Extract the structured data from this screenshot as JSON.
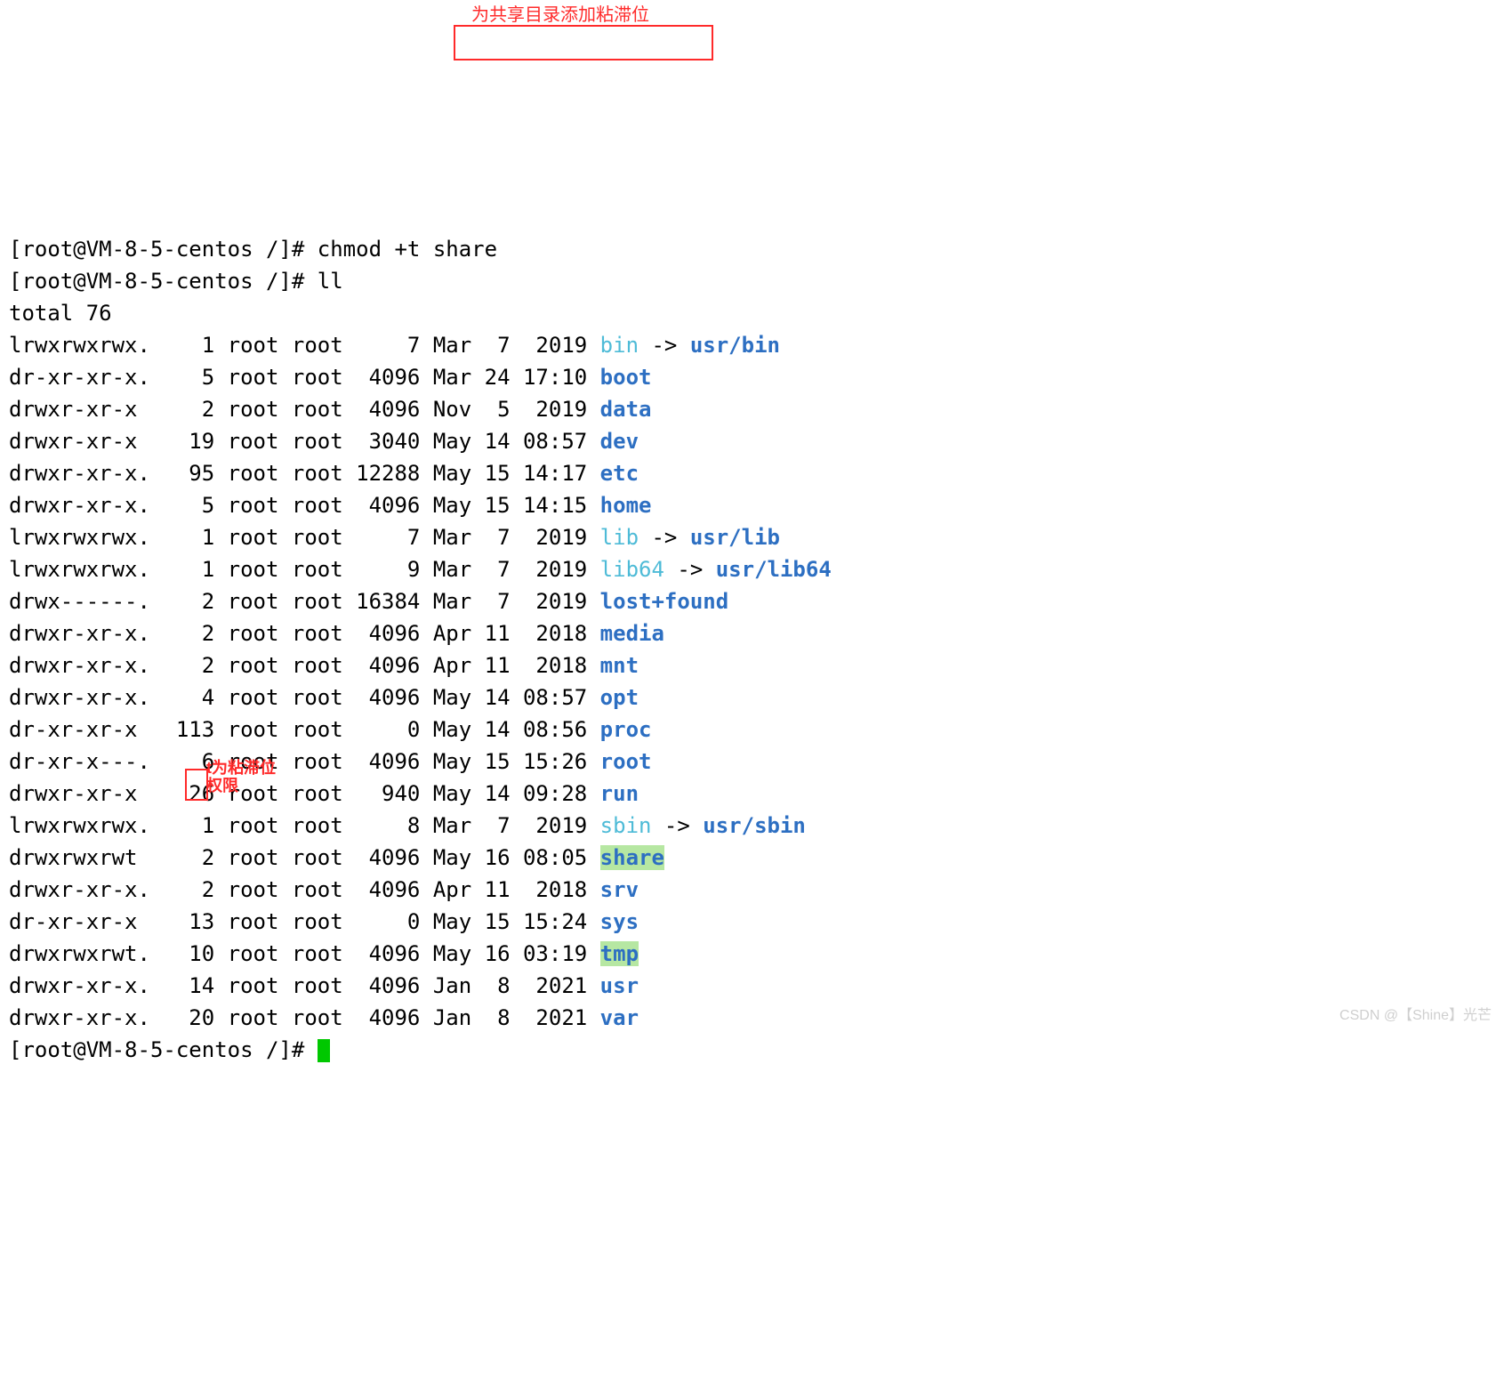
{
  "annotations": {
    "top_note": "为共享目录添加粘滞位",
    "mid_note": "t为粘滞位权限"
  },
  "watermark": "CSDN @【Shine】光芒",
  "prompt_line1_prefix": "[root@VM-8-5-centos /]# ",
  "prompt_line1_cmd": "chmod +t share",
  "prompt_line2_prefix": "[root@VM-8-5-centos /]# ",
  "prompt_line2_cmd": "ll",
  "total_line": "total 76",
  "rows": [
    {
      "perm": "lrwxrwxrwx.",
      "links": "1",
      "owner": "root",
      "group": "root",
      "size": "7",
      "month": "Mar",
      "day": "7",
      "time": "2019",
      "name": "bin",
      "cls": "cyan",
      "link": "usr/bin",
      "lcls": "blue"
    },
    {
      "perm": "dr-xr-xr-x.",
      "links": "5",
      "owner": "root",
      "group": "root",
      "size": "4096",
      "month": "Mar",
      "day": "24",
      "time": "17:10",
      "name": "boot",
      "cls": "blue"
    },
    {
      "perm": "drwxr-xr-x",
      "links": "2",
      "owner": "root",
      "group": "root",
      "size": "4096",
      "month": "Nov",
      "day": "5",
      "time": "2019",
      "name": "data",
      "cls": "blue"
    },
    {
      "perm": "drwxr-xr-x",
      "links": "19",
      "owner": "root",
      "group": "root",
      "size": "3040",
      "month": "May",
      "day": "14",
      "time": "08:57",
      "name": "dev",
      "cls": "blue"
    },
    {
      "perm": "drwxr-xr-x.",
      "links": "95",
      "owner": "root",
      "group": "root",
      "size": "12288",
      "month": "May",
      "day": "15",
      "time": "14:17",
      "name": "etc",
      "cls": "blue"
    },
    {
      "perm": "drwxr-xr-x.",
      "links": "5",
      "owner": "root",
      "group": "root",
      "size": "4096",
      "month": "May",
      "day": "15",
      "time": "14:15",
      "name": "home",
      "cls": "blue"
    },
    {
      "perm": "lrwxrwxrwx.",
      "links": "1",
      "owner": "root",
      "group": "root",
      "size": "7",
      "month": "Mar",
      "day": "7",
      "time": "2019",
      "name": "lib",
      "cls": "cyan",
      "link": "usr/lib",
      "lcls": "blue"
    },
    {
      "perm": "lrwxrwxrwx.",
      "links": "1",
      "owner": "root",
      "group": "root",
      "size": "9",
      "month": "Mar",
      "day": "7",
      "time": "2019",
      "name": "lib64",
      "cls": "cyan",
      "link": "usr/lib64",
      "lcls": "blue"
    },
    {
      "perm": "drwx------.",
      "links": "2",
      "owner": "root",
      "group": "root",
      "size": "16384",
      "month": "Mar",
      "day": "7",
      "time": "2019",
      "name": "lost+found",
      "cls": "blue"
    },
    {
      "perm": "drwxr-xr-x.",
      "links": "2",
      "owner": "root",
      "group": "root",
      "size": "4096",
      "month": "Apr",
      "day": "11",
      "time": "2018",
      "name": "media",
      "cls": "blue"
    },
    {
      "perm": "drwxr-xr-x.",
      "links": "2",
      "owner": "root",
      "group": "root",
      "size": "4096",
      "month": "Apr",
      "day": "11",
      "time": "2018",
      "name": "mnt",
      "cls": "blue"
    },
    {
      "perm": "drwxr-xr-x.",
      "links": "4",
      "owner": "root",
      "group": "root",
      "size": "4096",
      "month": "May",
      "day": "14",
      "time": "08:57",
      "name": "opt",
      "cls": "blue"
    },
    {
      "perm": "dr-xr-xr-x",
      "links": "113",
      "owner": "root",
      "group": "root",
      "size": "0",
      "month": "May",
      "day": "14",
      "time": "08:56",
      "name": "proc",
      "cls": "blue"
    },
    {
      "perm": "dr-xr-x---.",
      "links": "6",
      "owner": "root",
      "group": "root",
      "size": "4096",
      "month": "May",
      "day": "15",
      "time": "15:26",
      "name": "root",
      "cls": "blue"
    },
    {
      "perm": "drwxr-xr-x",
      "links": "26",
      "owner": "root",
      "group": "root",
      "size": "940",
      "month": "May",
      "day": "14",
      "time": "09:28",
      "name": "run",
      "cls": "blue"
    },
    {
      "perm": "lrwxrwxrwx.",
      "links": "1",
      "owner": "root",
      "group": "root",
      "size": "8",
      "month": "Mar",
      "day": "7",
      "time": "2019",
      "name": "sbin",
      "cls": "cyan",
      "link": "usr/sbin",
      "lcls": "blue"
    },
    {
      "perm": "drwxrwxrwt",
      "links": "2",
      "owner": "root",
      "group": "root",
      "size": "4096",
      "month": "May",
      "day": "16",
      "time": "08:05",
      "name": "share",
      "cls": "hl-green"
    },
    {
      "perm": "drwxr-xr-x.",
      "links": "2",
      "owner": "root",
      "group": "root",
      "size": "4096",
      "month": "Apr",
      "day": "11",
      "time": "2018",
      "name": "srv",
      "cls": "blue"
    },
    {
      "perm": "dr-xr-xr-x",
      "links": "13",
      "owner": "root",
      "group": "root",
      "size": "0",
      "month": "May",
      "day": "15",
      "time": "15:24",
      "name": "sys",
      "cls": "blue"
    },
    {
      "perm": "drwxrwxrwt.",
      "links": "10",
      "owner": "root",
      "group": "root",
      "size": "4096",
      "month": "May",
      "day": "16",
      "time": "03:19",
      "name": "tmp",
      "cls": "hl-green"
    },
    {
      "perm": "drwxr-xr-x.",
      "links": "14",
      "owner": "root",
      "group": "root",
      "size": "4096",
      "month": "Jan",
      "day": "8",
      "time": "2021",
      "name": "usr",
      "cls": "blue"
    },
    {
      "perm": "drwxr-xr-x.",
      "links": "20",
      "owner": "root",
      "group": "root",
      "size": "4096",
      "month": "Jan",
      "day": "8",
      "time": "2021",
      "name": "var",
      "cls": "blue"
    }
  ],
  "prompt_end": "[root@VM-8-5-centos /]# "
}
